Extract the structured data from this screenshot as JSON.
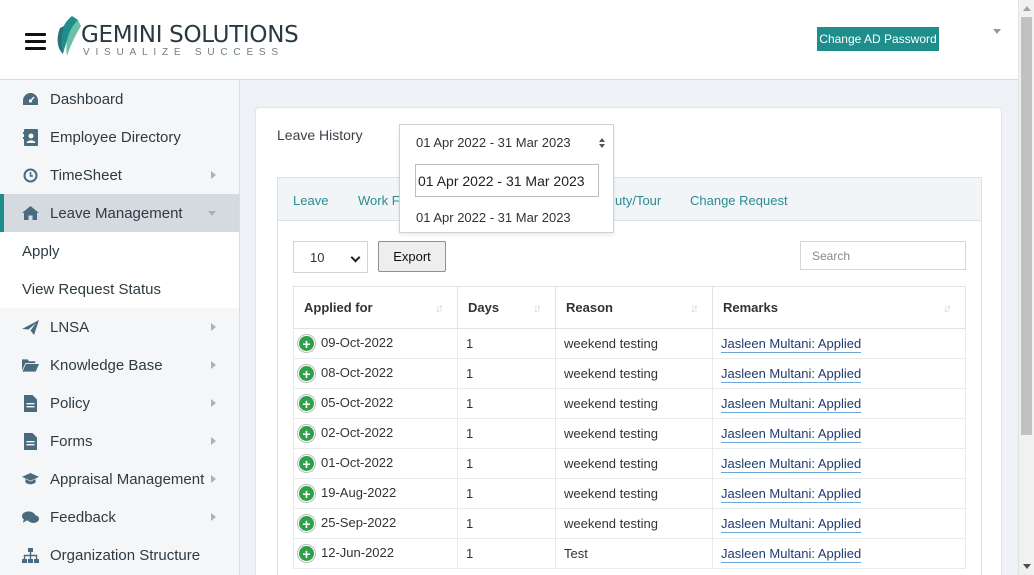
{
  "header": {
    "logo": {
      "name": "GEMINI SOLUTIONS",
      "tagline": "VISUALIZE SUCCESS"
    },
    "change_ad_password_label": "Change AD Password",
    "brand_color": "#1e8e8c"
  },
  "sidebar": {
    "items": [
      {
        "label": "Dashboard",
        "icon": "dashboard-icon"
      },
      {
        "label": "Employee Directory",
        "icon": "address-book-icon"
      },
      {
        "label": "TimeSheet",
        "icon": "clock-icon"
      },
      {
        "label": "Leave Management",
        "icon": "home-icon",
        "active": true
      },
      {
        "label": "LNSA",
        "icon": "plane-icon"
      },
      {
        "label": "Knowledge Base",
        "icon": "folder-open-icon"
      },
      {
        "label": "Policy",
        "icon": "file-icon"
      },
      {
        "label": "Forms",
        "icon": "file-icon"
      },
      {
        "label": "Appraisal Management",
        "icon": "graduation-cap-icon"
      },
      {
        "label": "Feedback",
        "icon": "comments-icon"
      },
      {
        "label": "Organization Structure",
        "icon": "sitemap-icon"
      }
    ],
    "sub_items": [
      "Apply",
      "View Request Status"
    ]
  },
  "main": {
    "title": "Leave History",
    "period": {
      "selected": "01 Apr 2022 - 31 Mar 2023",
      "search_value": "01 Apr 2022 - 31 Mar 2023",
      "options": [
        "01 Apr 2022 - 31 Mar 2023"
      ]
    },
    "tabs": [
      "Leave",
      "Work Fr",
      "uty/Tour",
      "Change Request"
    ],
    "table_controls": {
      "page_length": "10",
      "export_label": "Export",
      "search_placeholder": "Search"
    },
    "table": {
      "columns": [
        "Applied for",
        "Days",
        "Reason",
        "Remarks"
      ],
      "rows": [
        {
          "applied_for": "09-Oct-2022",
          "days": "1",
          "reason": "weekend testing",
          "remarks": "Jasleen Multani: Applied"
        },
        {
          "applied_for": "08-Oct-2022",
          "days": "1",
          "reason": "weekend testing",
          "remarks": "Jasleen Multani: Applied"
        },
        {
          "applied_for": "05-Oct-2022",
          "days": "1",
          "reason": "weekend testing",
          "remarks": "Jasleen Multani: Applied"
        },
        {
          "applied_for": "02-Oct-2022",
          "days": "1",
          "reason": "weekend testing",
          "remarks": "Jasleen Multani: Applied"
        },
        {
          "applied_for": "01-Oct-2022",
          "days": "1",
          "reason": "weekend testing",
          "remarks": "Jasleen Multani: Applied"
        },
        {
          "applied_for": "19-Aug-2022",
          "days": "1",
          "reason": "weekend testing",
          "remarks": "Jasleen Multani: Applied"
        },
        {
          "applied_for": "25-Sep-2022",
          "days": "1",
          "reason": "weekend testing",
          "remarks": "Jasleen Multani: Applied"
        },
        {
          "applied_for": "12-Jun-2022",
          "days": "1",
          "reason": "Test",
          "remarks": "Jasleen Multani: Applied"
        }
      ]
    }
  }
}
